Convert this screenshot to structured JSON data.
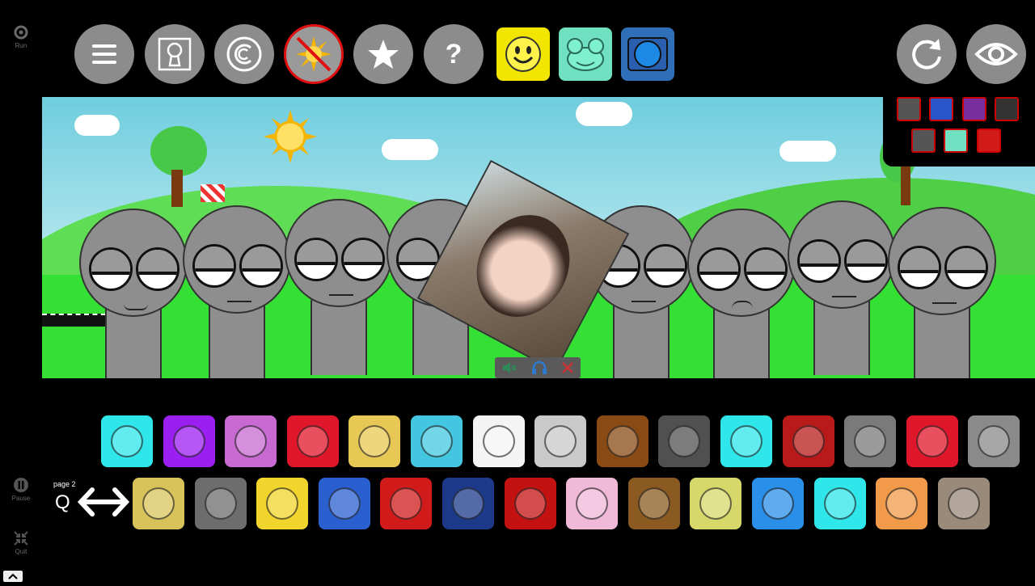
{
  "sidebar": {
    "run_label": "Run",
    "pause_label": "Pause",
    "quit_label": "Quit"
  },
  "toolbar": {
    "buttons": [
      {
        "icon": "hamburger-menu-icon"
      },
      {
        "icon": "keyhole-icon"
      },
      {
        "icon": "copyright-icon"
      },
      {
        "icon": "sun-disabled-icon"
      },
      {
        "icon": "star-icon"
      },
      {
        "icon": "help-icon",
        "label": "?"
      }
    ],
    "mode_buttons": [
      {
        "icon": "smiley-face-icon",
        "color": "#f2e600"
      },
      {
        "icon": "frog-face-icon",
        "color": "#6fe0c0"
      },
      {
        "icon": "tv-screen-icon",
        "color": "#3b7fd4"
      }
    ],
    "reset_icon": "refresh-icon",
    "view_icon": "eye-icon"
  },
  "mini_palette": {
    "row1": [
      "#555555",
      "#2a56c9",
      "#7a2e9e",
      "#333333"
    ],
    "row2": [
      "#555555",
      "#6fe0c0",
      "#d11a1a"
    ]
  },
  "video_overlay": {
    "controls": [
      "mute-icon",
      "headphones-icon",
      "close-icon"
    ]
  },
  "page_selector": {
    "label": "page 2",
    "key_label": "Q"
  },
  "palette": {
    "row1": [
      {
        "name": "cyan-bunny",
        "color": "#2fe6ea"
      },
      {
        "name": "purple-box",
        "color": "#9b1ff0"
      },
      {
        "name": "purple-computer",
        "color": "#c86ad2"
      },
      {
        "name": "red-phone",
        "color": "#e0162a"
      },
      {
        "name": "yellow-antenna",
        "color": "#e8c855"
      },
      {
        "name": "party-hat",
        "color": "#43c7e0"
      },
      {
        "name": "white-face",
        "color": "#f4f4f4"
      },
      {
        "name": "tophat",
        "color": "#c9c9c9"
      },
      {
        "name": "guitar",
        "color": "#8a4a14"
      },
      {
        "name": "party-cone",
        "color": "#505050"
      },
      {
        "name": "cyan-clock",
        "color": "#2fe6ea"
      },
      {
        "name": "red-cap",
        "color": "#b81a1a"
      },
      {
        "name": "gray-cat",
        "color": "#7a7a7a"
      },
      {
        "name": "red-flame",
        "color": "#e0162a"
      },
      {
        "name": "gray-horns",
        "color": "#8a8a8a"
      }
    ],
    "row2": [
      {
        "name": "yellow-smile",
        "color": "#d8c35a"
      },
      {
        "name": "gray-monster",
        "color": "#6d6d6d"
      },
      {
        "name": "yellow-tv",
        "color": "#f2d52c"
      },
      {
        "name": "blue-cap",
        "color": "#2a5fd0"
      },
      {
        "name": "roblox-cap",
        "color": "#d11a1a"
      },
      {
        "name": "yellow-bird",
        "color": "#1d3a8a"
      },
      {
        "name": "red-devil",
        "color": "#c41212"
      },
      {
        "name": "pink-bow",
        "color": "#f0b9d8"
      },
      {
        "name": "brown-bag",
        "color": "#8a5a20"
      },
      {
        "name": "green-egg",
        "color": "#d6d86a"
      },
      {
        "name": "blue-pirate",
        "color": "#2a8fe8"
      },
      {
        "name": "sunglasses",
        "color": "#2fe6ea"
      },
      {
        "name": "orange-robot",
        "color": "#f09a4a"
      },
      {
        "name": "photo-face",
        "color": "#9a8a7a"
      }
    ]
  }
}
